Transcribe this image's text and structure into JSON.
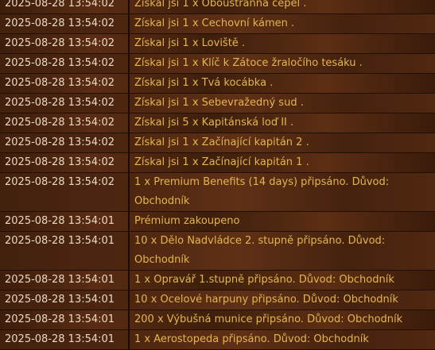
{
  "log": {
    "rows": [
      {
        "time": "2025-08-28 13:54:02",
        "message": "Získal jsi 1 x Oboustranná čepel ."
      },
      {
        "time": "2025-08-28 13:54:02",
        "message": "Získal jsi 1 x Cechovní kámen ."
      },
      {
        "time": "2025-08-28 13:54:02",
        "message": "Získal jsi 1 x Loviště ."
      },
      {
        "time": "2025-08-28 13:54:02",
        "message": "Získal jsi 1 x Klíč k Zátoce žraločího tesáku ."
      },
      {
        "time": "2025-08-28 13:54:02",
        "message": "Získal jsi 1 x Tvá kocábka ."
      },
      {
        "time": "2025-08-28 13:54:02",
        "message": "Získal jsi 1 x Sebevražedný sud ."
      },
      {
        "time": "2025-08-28 13:54:02",
        "message": "Získal jsi 5 x Kapitánská loď II ."
      },
      {
        "time": "2025-08-28 13:54:02",
        "message": "Získal jsi 1 x Začínající kapitán 2 ."
      },
      {
        "time": "2025-08-28 13:54:02",
        "message": "Získal jsi 1 x Začínající kapitán 1 ."
      },
      {
        "time": "2025-08-28 13:54:02",
        "message": "1 x Premium Benefits (14 days) připsáno. Důvod:",
        "message2": "Obchodník"
      },
      {
        "time": "2025-08-28 13:54:01",
        "message": "Prémium zakoupeno"
      },
      {
        "time": "2025-08-28 13:54:01",
        "message": "10 x Dělo Nadvládce 2. stupně připsáno. Důvod:",
        "message2": "Obchodník"
      },
      {
        "time": "2025-08-28 13:54:01",
        "message": "1 x Opravář 1.stupně připsáno. Důvod: Obchodník"
      },
      {
        "time": "2025-08-28 13:54:01",
        "message": "10 x Ocelové harpuny připsáno. Důvod: Obchodník"
      },
      {
        "time": "2025-08-28 13:54:01",
        "message": "200 x Výbušná munice připsáno. Důvod: Obchodník"
      },
      {
        "time": "2025-08-28 13:54:01",
        "message": "1 x Aerostopeda připsáno. Důvod: Obchodník"
      }
    ]
  }
}
